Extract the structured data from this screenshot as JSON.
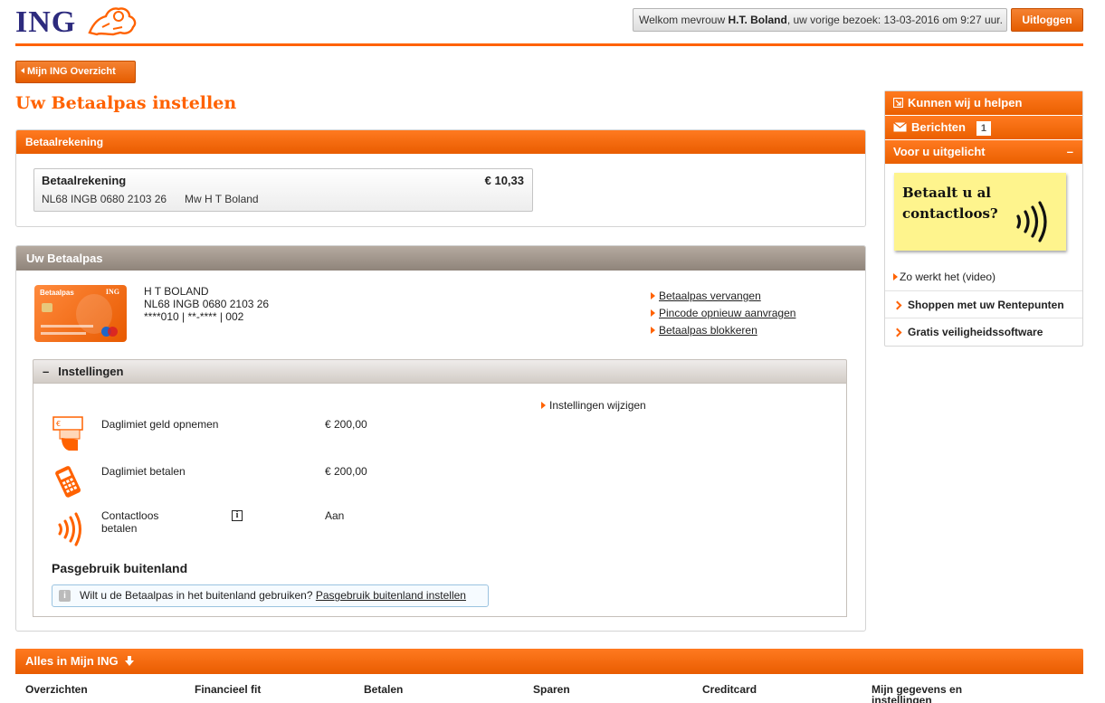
{
  "header": {
    "logo_text": "ING",
    "welcome_prefix": "Welkom mevrouw ",
    "welcome_name": "H.T. Boland",
    "welcome_suffix": ", uw vorige bezoek: 13-03-2016 om 9:27 uur.",
    "logout_label": "Uitloggen"
  },
  "nav": {
    "back_label": "Mijn ING Overzicht"
  },
  "page_title": "Uw Betaalpas instellen",
  "account_panel": {
    "title": "Betaalrekening",
    "account_name": "Betaalrekening",
    "balance": "€ 10,33",
    "iban": "NL68 INGB 0680 2103 26",
    "holder": "Mw H T Boland"
  },
  "card_panel": {
    "title": "Uw Betaalpas",
    "card_image_label": "Betaalpas",
    "card_image_brand": "ING",
    "holder": "H T BOLAND",
    "iban": "NL68 INGB 0680 2103 26",
    "card_number": "****010 | **-**** | 002",
    "actions": [
      "Betaalpas vervangen",
      "Pincode opnieuw aanvragen",
      "Betaalpas blokkeren"
    ]
  },
  "settings": {
    "toggle": "–",
    "title": "Instellingen",
    "edit_link": "Instellingen wijzigen",
    "rows": [
      {
        "label": "Daglimiet geld opnemen",
        "value": "€ 200,00",
        "icon": "atm-cash-icon"
      },
      {
        "label": "Daglimiet betalen",
        "value": "€ 200,00",
        "icon": "payment-terminal-icon"
      },
      {
        "label": "Contactloos betalen",
        "value": "Aan",
        "icon": "contactless-icon"
      }
    ],
    "info_glyph": "i",
    "abroad_title": "Pasgebruik buitenland",
    "abroad_text": "Wilt u de Betaalpas in het buitenland gebruiken? ",
    "abroad_link": "Pasgebruik buitenland instellen"
  },
  "sidebar": {
    "help": "Kunnen wij u helpen",
    "messages": "Berichten",
    "messages_count": "1",
    "featured": "Voor u uitgelicht",
    "featured_toggle": "–",
    "promo_text": "Betaalt u al contactloos?",
    "video_link": "Zo werkt het (video)",
    "links": [
      "Shoppen met uw Rentepunten",
      "Gratis veiligheidssoftware"
    ]
  },
  "footer": {
    "title": "Alles in Mijn ING",
    "arrow": "🡇",
    "columns": [
      "Overzichten",
      "Financieel fit",
      "Betalen",
      "Sparen",
      "Creditcard",
      "Mijn gegevens en instellingen"
    ]
  },
  "colors": {
    "brand_orange": "#ff6200",
    "brand_blue": "#2d2b7e",
    "promo_yellow": "#fef48d"
  }
}
